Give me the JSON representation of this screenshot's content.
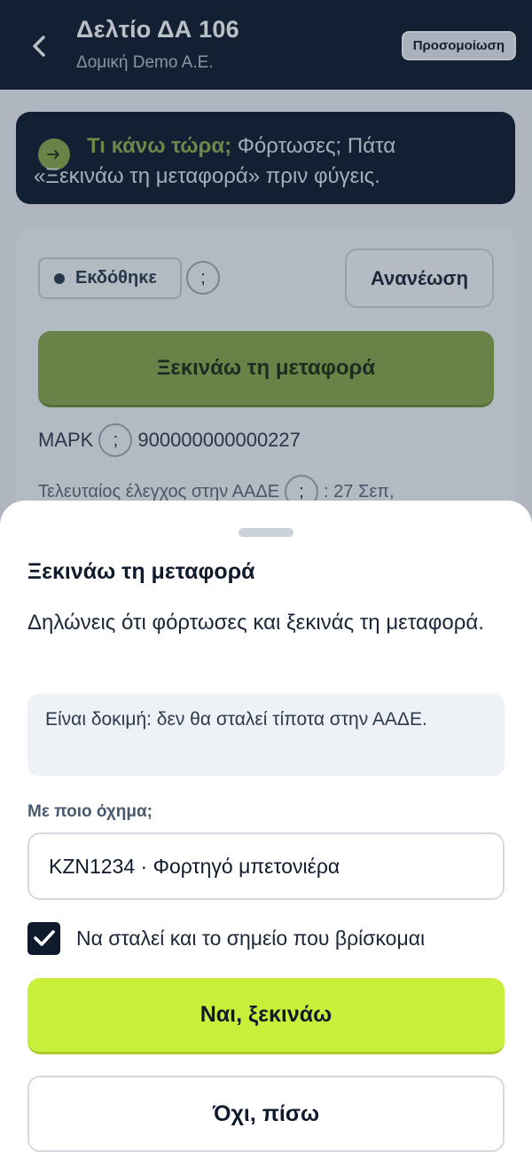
{
  "header": {
    "title": "Δελτίο ΔΑ 106",
    "subtitle": "Δομική Demo A.E.",
    "badge": "Προσομοίωση"
  },
  "hint": {
    "lead": "Τι κάνω τώρα;",
    "text1": " Φόρτωσες; Πάτα",
    "text2": "«Ξεκινάω τη μεταφορά» πριν φύγεις."
  },
  "card": {
    "status": "Εκδόθηκε",
    "help": ";",
    "refresh_label": "Ανανέωση",
    "start_label": "Ξεκινάω τη μεταφορά",
    "mark_label": "ΜΑΡΚ",
    "mark_value": "900000000000227",
    "last_check_label": "Τελευταίος έλεγχος στην ΑΑΔΕ",
    "last_check_value": ": 27 Σεπ,"
  },
  "sheet": {
    "title": "Ξεκινάω τη μεταφορά",
    "description": "Δηλώνεις ότι φόρτωσες και ξεκινάς τη μεταφορά.",
    "info": "Είναι δοκιμή: δεν θα σταλεί τίποτα στην ΑΑΔΕ.",
    "vehicle_label": "Με ποιο όχημα;",
    "vehicle_value": "KZN1234 · Φορτηγό μπετονιέρα",
    "send_location_label": "Να σταλεί και το σημείο που βρίσκομαι",
    "send_location_checked": true,
    "confirm_label": "Ναι, ξεκινάω",
    "cancel_label": "Όχι, πίσω"
  },
  "colors": {
    "navy": "#0f1b2d",
    "olive": "#8aa64a",
    "lime": "#c8ef3a"
  }
}
